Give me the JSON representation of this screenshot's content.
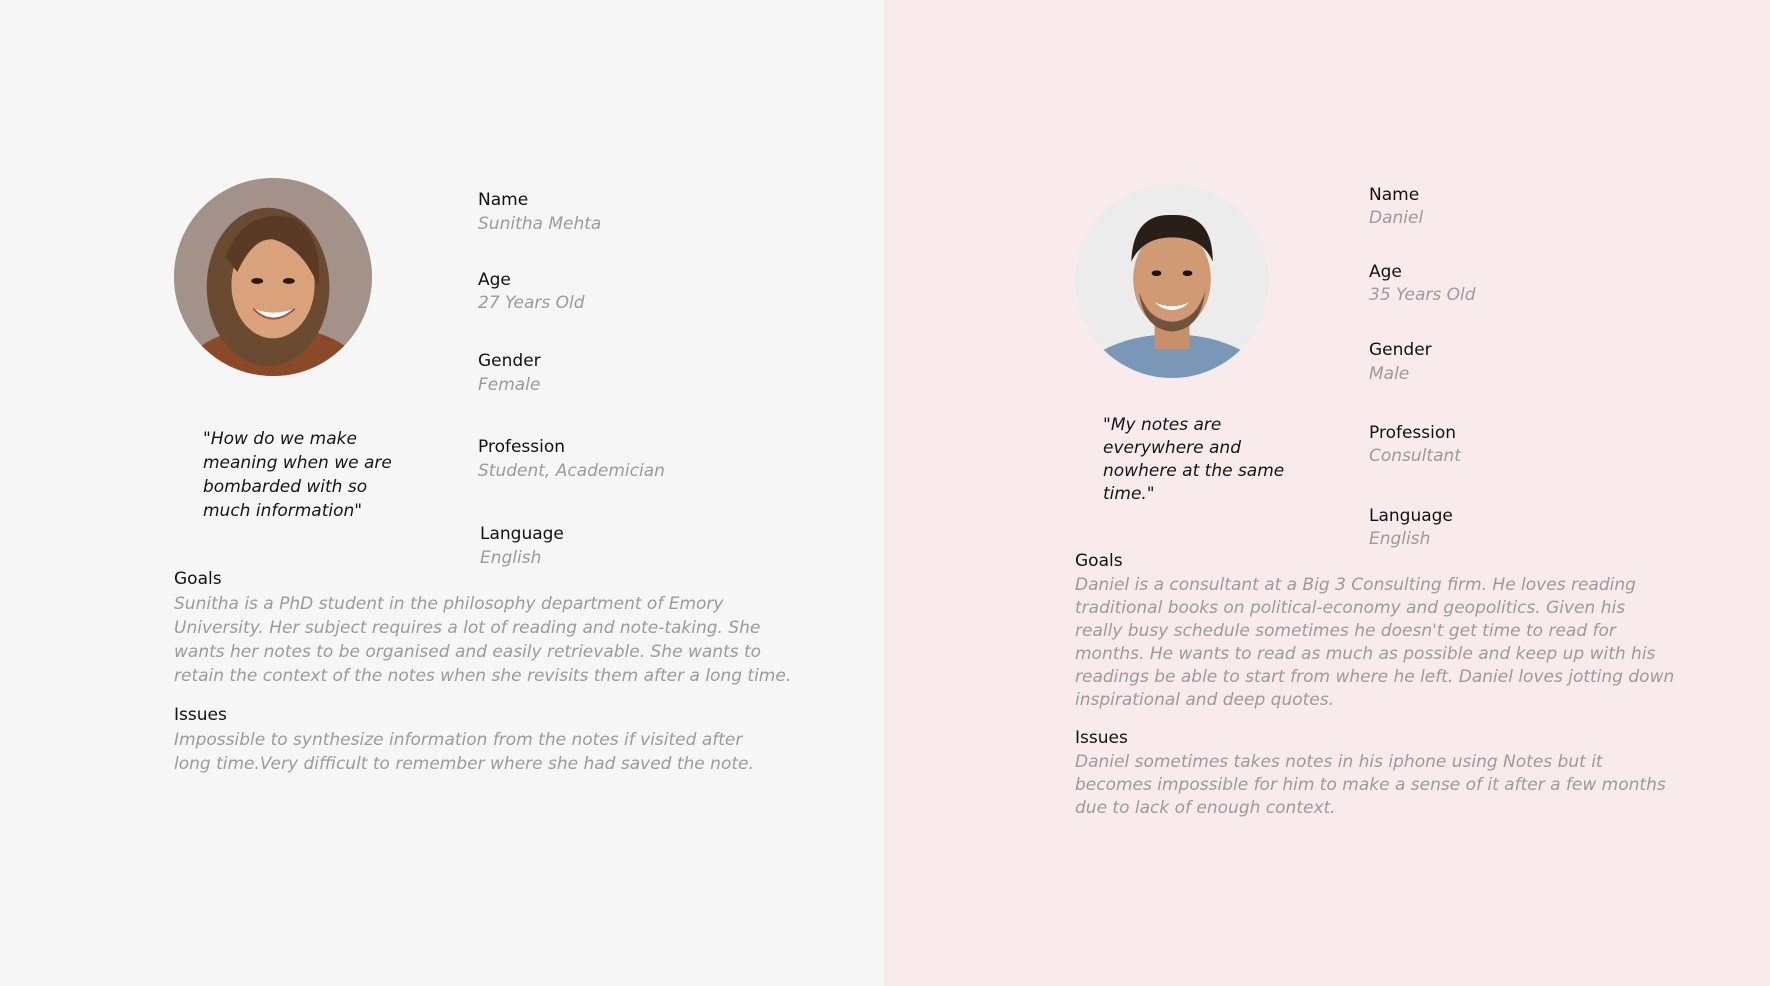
{
  "personas": [
    {
      "name_label": "Name",
      "name_value": "Sunitha Mehta",
      "age_label": "Age",
      "age_value": "27 Years Old",
      "gender_label": "Gender",
      "gender_value": "Female",
      "profession_label": "Profession",
      "profession_value": "Student, Academician",
      "language_label": "Language",
      "language_value": "English",
      "quote": "\"How do we make\nmeaning when we are\nbombarded with so\nmuch information\"",
      "goals_label": "Goals",
      "goals_text": "Sunitha is a PhD student in the philosophy department of Emory\nUniversity. Her subject requires a lot of reading and note-taking. She\nwants her notes to be organised and easily retrievable. She wants to\nretain the context of the notes when she revisits them after a long time.",
      "issues_label": "Issues",
      "issues_text": "Impossible to synthesize information from the notes if visited after\nlong time.Very difficult to remember where she had saved the note."
    },
    {
      "name_label": "Name",
      "name_value": "Daniel",
      "age_label": "Age",
      "age_value": "35 Years Old",
      "gender_label": "Gender",
      "gender_value": "Male",
      "profession_label": "Profession",
      "profession_value": "Consultant",
      "language_label": "Language",
      "language_value": "English",
      "quote": "\"My notes are\neverywhere and\nnowhere at the same\ntime.\"",
      "goals_label": "Goals",
      "goals_text": "Daniel is a consultant at a Big 3 Consulting firm. He loves reading\ntraditional books on political-economy and geopolitics. Given his\nreally busy schedule sometimes he doesn't get time to read for\nmonths. He wants to read as much as possible and keep up with his\nreadings be able to start from where he left. Daniel loves jotting down\ninspirational and deep quotes.",
      "issues_label": "Issues",
      "issues_text": "Daniel sometimes takes notes in his iphone using Notes but it\nbecomes impossible for him to make a sense of it after a few months\ndue to lack of enough context."
    }
  ],
  "colors": {
    "left_bg": "#f7f6f7",
    "right_bg": "#f9ebec",
    "label_color": "#111111",
    "value_color": "#9b9b9b"
  }
}
